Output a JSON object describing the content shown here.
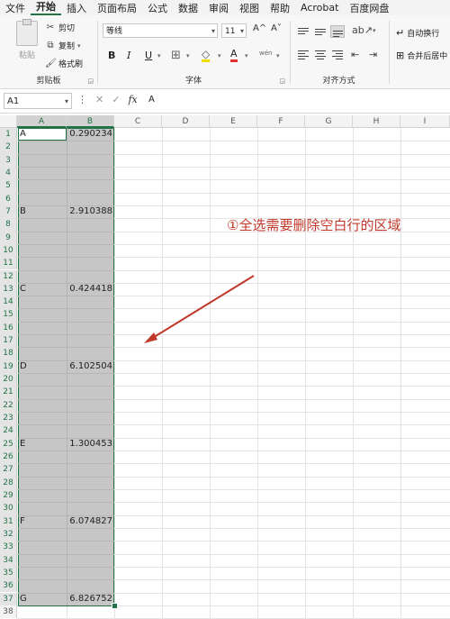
{
  "menu": [
    "文件",
    "开始",
    "插入",
    "页面布局",
    "公式",
    "数据",
    "审阅",
    "视图",
    "帮助",
    "Acrobat",
    "百度网盘"
  ],
  "active_menu_index": 1,
  "clipboard": {
    "paste_label": "粘贴",
    "cut_label": "剪切",
    "copy_label": "复制",
    "format_painter_label": "格式刷",
    "group_label": "剪贴板"
  },
  "font": {
    "name": "等线",
    "size": "11",
    "grow_label": "A^",
    "shrink_label": "A˅",
    "bold": "B",
    "italic": "I",
    "underline": "U",
    "font_color_letter": "A",
    "phonetic_label": "wén",
    "group_label": "字体"
  },
  "alignment": {
    "wrap_label": "自动换行",
    "merge_label": "合并后居中",
    "group_label": "对齐方式"
  },
  "formula_bar": {
    "name_box": "A1",
    "fx_label": "fx",
    "value": "A"
  },
  "columns": [
    "A",
    "B",
    "C",
    "D",
    "E",
    "F",
    "G",
    "H",
    "I"
  ],
  "rows": [
    1,
    2,
    3,
    4,
    5,
    6,
    7,
    8,
    9,
    10,
    11,
    12,
    13,
    14,
    15,
    16,
    17,
    18,
    19,
    20,
    21,
    22,
    23,
    24,
    25,
    26,
    27,
    28,
    29,
    30,
    31,
    32,
    33,
    34,
    35,
    36,
    37,
    38
  ],
  "cells": [
    {
      "row": 1,
      "a": "A",
      "b": "0.290234"
    },
    {
      "row": 7,
      "a": "B",
      "b": "2.910388"
    },
    {
      "row": 13,
      "a": "C",
      "b": "0.424418"
    },
    {
      "row": 19,
      "a": "D",
      "b": "6.102504"
    },
    {
      "row": 25,
      "a": "E",
      "b": "1.300453"
    },
    {
      "row": 31,
      "a": "F",
      "b": "6.074827"
    },
    {
      "row": 37,
      "a": "G",
      "b": "6.826752"
    }
  ],
  "annotation": "①全选需要删除空白行的区域",
  "colors": {
    "accent": "#217346",
    "annotation": "#c0392b",
    "selection": "#c6c6c6"
  }
}
